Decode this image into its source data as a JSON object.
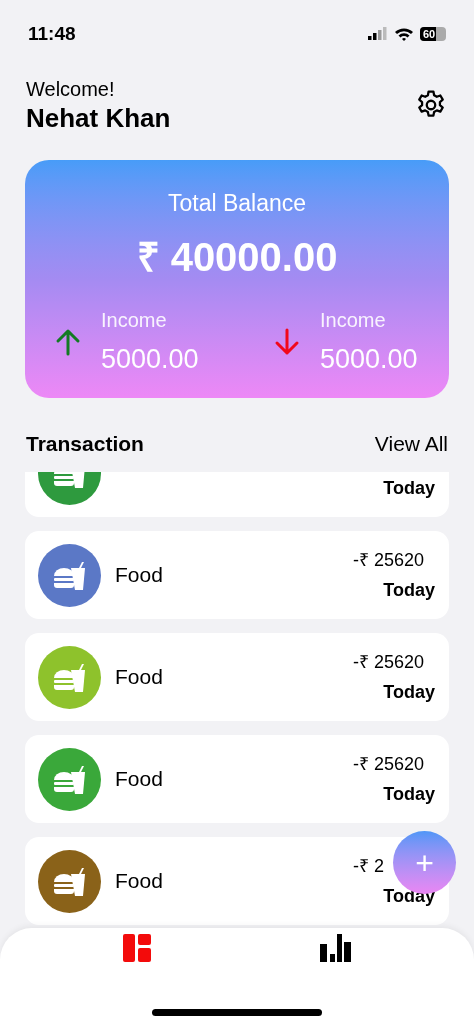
{
  "status_bar": {
    "time": "11:48",
    "battery": "60"
  },
  "header": {
    "greeting": "Welcome!",
    "name": "Nehat Khan"
  },
  "balance_card": {
    "title": "Total Balance",
    "amount": "₹ 40000.00",
    "stats": [
      {
        "kind": "up",
        "label": "Income",
        "value": "5000.00"
      },
      {
        "kind": "down",
        "label": "Income",
        "value": "5000.00"
      }
    ]
  },
  "transactions": {
    "title": "Transaction",
    "view_all": "View All",
    "items": [
      {
        "color": "#2e9a3e",
        "date": "Today"
      },
      {
        "color": "#5b78c6",
        "title": "Food",
        "amount": "-₹ 25620",
        "date": "Today"
      },
      {
        "color": "#8ec22c",
        "title": "Food",
        "amount": "-₹ 25620",
        "date": "Today"
      },
      {
        "color": "#3aa83a",
        "title": "Food",
        "amount": "-₹ 25620",
        "date": "Today"
      },
      {
        "color": "#8a6219",
        "title": "Food",
        "amount": "-₹ 2",
        "date": "Today"
      }
    ]
  },
  "fab": {
    "label": "+"
  },
  "tab_bar": [
    {
      "kind": "dashboard",
      "selected": true
    },
    {
      "kind": "chart",
      "selected": false
    }
  ]
}
